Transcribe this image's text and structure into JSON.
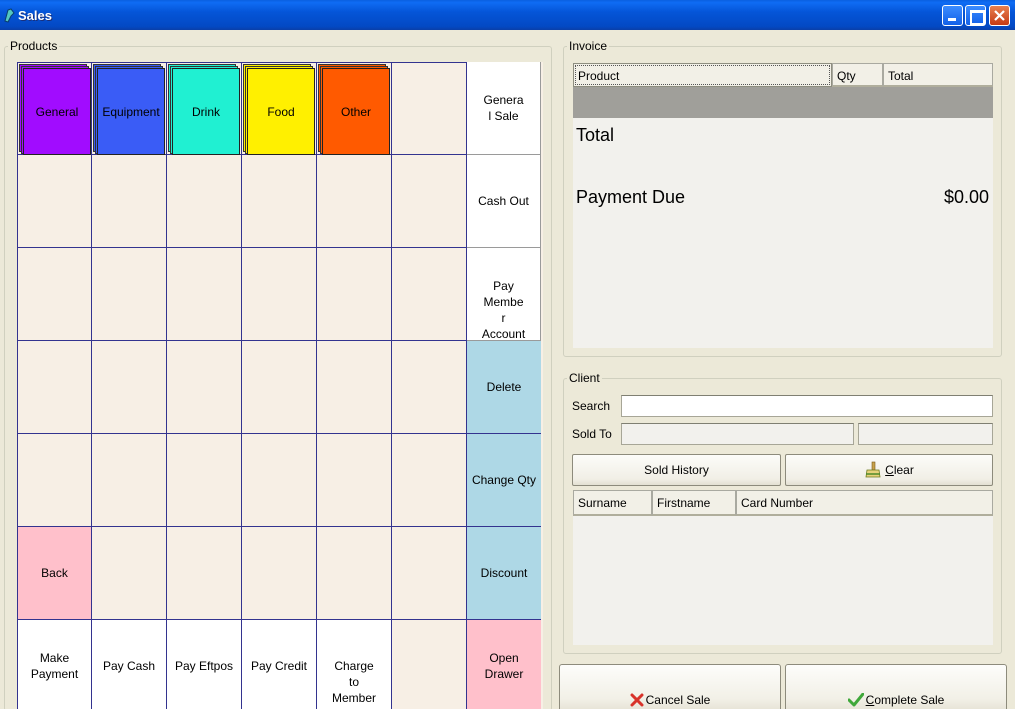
{
  "window": {
    "title": "Sales"
  },
  "products": {
    "legend": "Products",
    "categories": [
      {
        "label": "General",
        "color": "#a10cff"
      },
      {
        "label": "Equipment",
        "color": "#3a5cf6"
      },
      {
        "label": "Drink",
        "color": "#20f0d2"
      },
      {
        "label": "Food",
        "color": "#fff000"
      },
      {
        "label": "Other",
        "color": "#ff5a00"
      }
    ],
    "actions": {
      "general_sale": "Genera\nl Sale",
      "cash_out": "Cash Out",
      "pay_member_account": "Pay\nMembe\nr\nAccount",
      "delete": "Delete",
      "change_qty": "Change Qty",
      "discount": "Discount",
      "back": "Back",
      "make_payment": "Make\nPayment",
      "pay_cash": "Pay Cash",
      "pay_eftpos": "Pay Eftpos",
      "pay_credit": "Pay Credit",
      "charge_to_member": "Charge\nto\nMember",
      "open_drawer": "Open\nDrawer"
    }
  },
  "invoice": {
    "legend": "Invoice",
    "columns": [
      "Product",
      "Qty",
      "Total"
    ],
    "total_label": "Total",
    "payment_due_label": "Payment Due",
    "payment_due_value": "$0.00"
  },
  "client": {
    "legend": "Client",
    "search_label": "Search",
    "search_value": "",
    "sold_to_label": "Sold To",
    "sold_to_value": "",
    "sold_to_extra": "",
    "sold_history_label": "Sold History",
    "clear_label": "Clear",
    "clear_mnemonic": "C",
    "columns": [
      "Surname",
      "Firstname",
      "Card Number"
    ]
  },
  "footer": {
    "cancel_label": "Cancel Sale",
    "complete_label": "Complete Sale",
    "complete_mnemonic": "C"
  }
}
